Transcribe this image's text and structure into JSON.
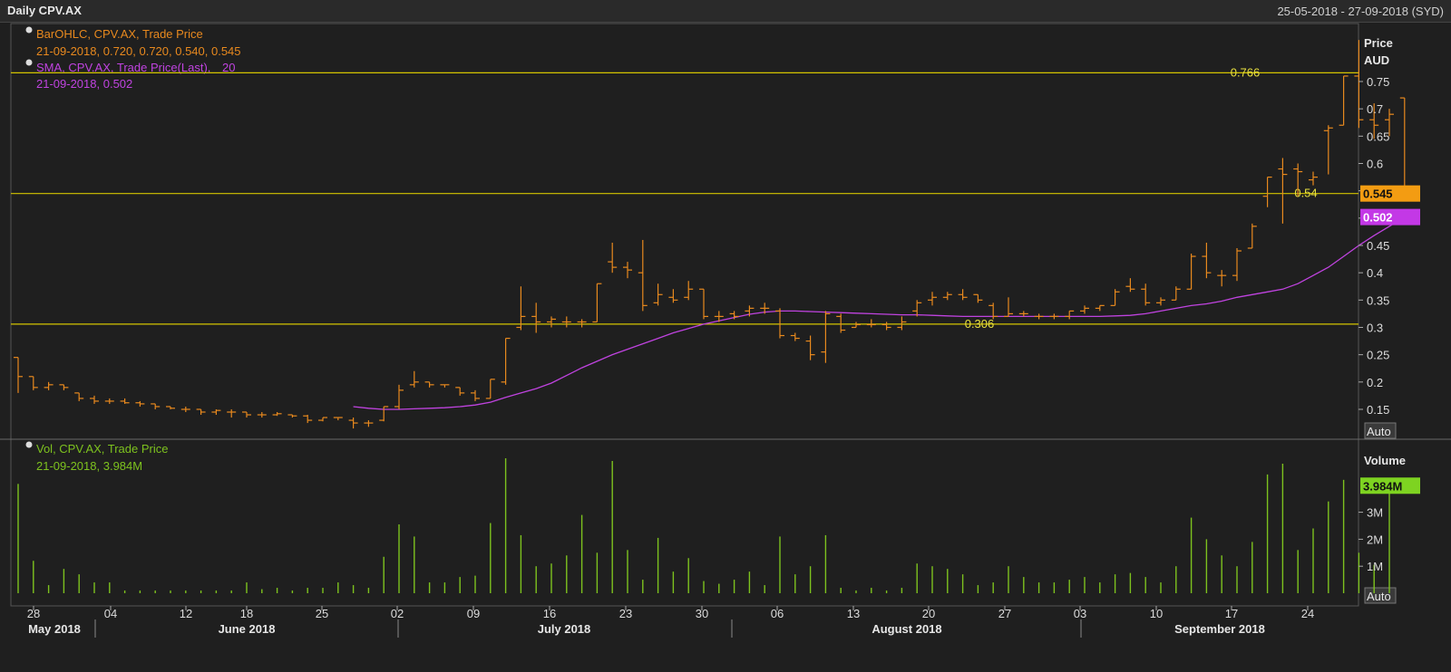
{
  "header": {
    "title": "Daily CPV.AX",
    "date_range": "25-05-2018 - 27-09-2018 (SYD)"
  },
  "legend": {
    "ohlc_label": "BarOHLC, CPV.AX, Trade Price",
    "ohlc_values": "21-09-2018, 0.720, 0.720, 0.540, 0.545",
    "sma_label": "SMA, CPV.AX, Trade Price(Last),",
    "sma_period": "20",
    "sma_values": "21-09-2018, 0.502",
    "vol_label": "Vol, CPV.AX, Trade Price",
    "vol_values": "21-09-2018, 3.984M"
  },
  "price_axis": {
    "title_line1": "Price",
    "title_line2": "AUD",
    "ticks": [
      "0.75",
      "0.7",
      "0.65",
      "0.6",
      "0.55",
      "0.5",
      "0.45",
      "0.4",
      "0.35",
      "0.3",
      "0.25",
      "0.2",
      "0.15"
    ],
    "last_price_tag": "0.545",
    "sma_tag": "0.502",
    "auto_label": "Auto"
  },
  "volume_axis": {
    "title": "Volume",
    "ticks": [
      "3M",
      "2M",
      "1M"
    ],
    "last_volume_tag": "3.984M",
    "auto_label": "Auto"
  },
  "hlines": [
    {
      "value": 0.766,
      "label": "0.766"
    },
    {
      "value": 0.545,
      "label": "0.54"
    },
    {
      "value": 0.306,
      "label": "0.306"
    }
  ],
  "time_axis": {
    "day_ticks": [
      "28",
      "04",
      "12",
      "18",
      "25",
      "02",
      "09",
      "16",
      "23",
      "30",
      "06",
      "13",
      "20",
      "27",
      "03",
      "10",
      "17",
      "24"
    ],
    "months": [
      "May 2018",
      "June 2018",
      "July 2018",
      "August 2018",
      "September 2018"
    ]
  },
  "colors": {
    "ohlc": "#e8891e",
    "sma": "#c043e0",
    "volume": "#7dc21e",
    "hline": "#d4c400",
    "last_tag": "#f39c12",
    "sma_tag": "#c338e6",
    "vol_tag": "#7ed321"
  },
  "chart_data": {
    "type": "bar",
    "title": "Daily CPV.AX",
    "ylabel": "Price AUD",
    "ylim": [
      0.115,
      0.835
    ],
    "ohlc": [
      [
        0.245,
        0.245,
        0.18,
        0.21
      ],
      [
        0.21,
        0.21,
        0.185,
        0.19
      ],
      [
        0.19,
        0.2,
        0.185,
        0.195
      ],
      [
        0.195,
        0.195,
        0.185,
        0.19
      ],
      [
        0.18,
        0.18,
        0.165,
        0.17
      ],
      [
        0.17,
        0.175,
        0.16,
        0.165
      ],
      [
        0.165,
        0.17,
        0.16,
        0.165
      ],
      [
        0.165,
        0.17,
        0.16,
        0.162
      ],
      [
        0.162,
        0.165,
        0.155,
        0.16
      ],
      [
        0.16,
        0.16,
        0.15,
        0.155
      ],
      [
        0.155,
        0.155,
        0.15,
        0.152
      ],
      [
        0.15,
        0.155,
        0.145,
        0.15
      ],
      [
        0.15,
        0.15,
        0.14,
        0.145
      ],
      [
        0.145,
        0.15,
        0.14,
        0.148
      ],
      [
        0.145,
        0.15,
        0.135,
        0.145
      ],
      [
        0.145,
        0.145,
        0.135,
        0.14
      ],
      [
        0.14,
        0.145,
        0.135,
        0.14
      ],
      [
        0.14,
        0.145,
        0.138,
        0.142
      ],
      [
        0.14,
        0.14,
        0.135,
        0.138
      ],
      [
        0.138,
        0.14,
        0.125,
        0.13
      ],
      [
        0.13,
        0.135,
        0.128,
        0.135
      ],
      [
        0.135,
        0.135,
        0.13,
        0.135
      ],
      [
        0.13,
        0.135,
        0.115,
        0.125
      ],
      [
        0.125,
        0.13,
        0.118,
        0.125
      ],
      [
        0.13,
        0.155,
        0.128,
        0.155
      ],
      [
        0.155,
        0.195,
        0.15,
        0.185
      ],
      [
        0.195,
        0.22,
        0.19,
        0.2
      ],
      [
        0.2,
        0.2,
        0.19,
        0.195
      ],
      [
        0.195,
        0.195,
        0.19,
        0.195
      ],
      [
        0.19,
        0.19,
        0.175,
        0.18
      ],
      [
        0.18,
        0.185,
        0.165,
        0.17
      ],
      [
        0.17,
        0.205,
        0.17,
        0.205
      ],
      [
        0.2,
        0.28,
        0.195,
        0.28
      ],
      [
        0.3,
        0.375,
        0.295,
        0.32
      ],
      [
        0.32,
        0.345,
        0.29,
        0.31
      ],
      [
        0.31,
        0.32,
        0.3,
        0.315
      ],
      [
        0.31,
        0.32,
        0.3,
        0.31
      ],
      [
        0.31,
        0.315,
        0.3,
        0.31
      ],
      [
        0.31,
        0.38,
        0.31,
        0.38
      ],
      [
        0.42,
        0.455,
        0.4,
        0.41
      ],
      [
        0.41,
        0.42,
        0.39,
        0.405
      ],
      [
        0.4,
        0.46,
        0.33,
        0.34
      ],
      [
        0.345,
        0.38,
        0.34,
        0.36
      ],
      [
        0.355,
        0.37,
        0.345,
        0.35
      ],
      [
        0.355,
        0.385,
        0.35,
        0.37
      ],
      [
        0.37,
        0.37,
        0.315,
        0.32
      ],
      [
        0.32,
        0.33,
        0.31,
        0.32
      ],
      [
        0.325,
        0.33,
        0.315,
        0.32
      ],
      [
        0.33,
        0.34,
        0.32,
        0.335
      ],
      [
        0.335,
        0.345,
        0.325,
        0.335
      ],
      [
        0.33,
        0.335,
        0.28,
        0.285
      ],
      [
        0.285,
        0.29,
        0.275,
        0.28
      ],
      [
        0.275,
        0.285,
        0.24,
        0.25
      ],
      [
        0.255,
        0.33,
        0.235,
        0.325
      ],
      [
        0.32,
        0.325,
        0.29,
        0.295
      ],
      [
        0.3,
        0.31,
        0.3,
        0.305
      ],
      [
        0.305,
        0.315,
        0.3,
        0.305
      ],
      [
        0.305,
        0.31,
        0.295,
        0.3
      ],
      [
        0.3,
        0.32,
        0.295,
        0.31
      ],
      [
        0.33,
        0.35,
        0.32,
        0.345
      ],
      [
        0.35,
        0.365,
        0.34,
        0.355
      ],
      [
        0.355,
        0.365,
        0.35,
        0.36
      ],
      [
        0.36,
        0.37,
        0.35,
        0.355
      ],
      [
        0.36,
        0.36,
        0.345,
        0.35
      ],
      [
        0.34,
        0.345,
        0.315,
        0.32
      ],
      [
        0.32,
        0.355,
        0.32,
        0.325
      ],
      [
        0.325,
        0.33,
        0.32,
        0.325
      ],
      [
        0.32,
        0.325,
        0.315,
        0.32
      ],
      [
        0.32,
        0.325,
        0.315,
        0.32
      ],
      [
        0.32,
        0.33,
        0.315,
        0.33
      ],
      [
        0.33,
        0.34,
        0.325,
        0.335
      ],
      [
        0.335,
        0.34,
        0.33,
        0.34
      ],
      [
        0.34,
        0.37,
        0.34,
        0.365
      ],
      [
        0.375,
        0.39,
        0.365,
        0.37
      ],
      [
        0.37,
        0.38,
        0.34,
        0.345
      ],
      [
        0.345,
        0.355,
        0.34,
        0.35
      ],
      [
        0.35,
        0.375,
        0.35,
        0.37
      ],
      [
        0.37,
        0.435,
        0.37,
        0.43
      ],
      [
        0.43,
        0.455,
        0.39,
        0.4
      ],
      [
        0.395,
        0.405,
        0.375,
        0.395
      ],
      [
        0.395,
        0.445,
        0.385,
        0.44
      ],
      [
        0.445,
        0.49,
        0.445,
        0.485
      ],
      [
        0.54,
        0.575,
        0.52,
        0.575
      ],
      [
        0.59,
        0.61,
        0.49,
        0.58
      ],
      [
        0.59,
        0.6,
        0.54,
        0.585
      ],
      [
        0.57,
        0.585,
        0.56,
        0.575
      ],
      [
        0.66,
        0.67,
        0.58,
        0.665
      ],
      [
        0.67,
        0.76,
        0.67,
        0.76
      ],
      [
        0.76,
        0.826,
        0.665,
        0.68
      ],
      [
        0.68,
        0.71,
        0.645,
        0.67
      ],
      [
        0.68,
        0.7,
        0.65,
        0.69
      ],
      [
        0.72,
        0.72,
        0.54,
        0.545
      ]
    ],
    "sma": [
      0.155,
      0.152,
      0.15,
      0.15,
      0.151,
      0.152,
      0.153,
      0.155,
      0.158,
      0.163,
      0.172,
      0.18,
      0.188,
      0.198,
      0.212,
      0.226,
      0.238,
      0.25,
      0.26,
      0.27,
      0.28,
      0.29,
      0.298,
      0.306,
      0.312,
      0.318,
      0.324,
      0.328,
      0.33,
      0.33,
      0.329,
      0.328,
      0.327,
      0.326,
      0.325,
      0.324,
      0.323,
      0.323,
      0.322,
      0.321,
      0.32,
      0.32,
      0.32,
      0.32,
      0.32,
      0.32,
      0.32,
      0.32,
      0.32,
      0.32,
      0.321,
      0.322,
      0.325,
      0.33,
      0.335,
      0.34,
      0.343,
      0.348,
      0.355,
      0.36,
      0.365,
      0.37,
      0.38,
      0.395,
      0.41,
      0.43,
      0.45,
      0.468,
      0.485,
      0.502
    ],
    "volume_millions": [
      4.05,
      1.2,
      0.3,
      0.9,
      0.7,
      0.4,
      0.4,
      0.1,
      0.1,
      0.1,
      0.1,
      0.1,
      0.1,
      0.1,
      0.1,
      0.4,
      0.15,
      0.2,
      0.1,
      0.2,
      0.2,
      0.4,
      0.3,
      0.2,
      1.35,
      2.55,
      2.1,
      0.4,
      0.4,
      0.6,
      0.65,
      2.6,
      5.0,
      2.15,
      1.0,
      1.1,
      1.4,
      2.9,
      1.5,
      4.9,
      1.6,
      0.5,
      2.05,
      0.8,
      1.3,
      0.45,
      0.35,
      0.5,
      0.8,
      0.3,
      2.1,
      0.7,
      1.0,
      2.15,
      0.2,
      0.1,
      0.2,
      0.1,
      0.2,
      1.1,
      1.0,
      0.9,
      0.7,
      0.3,
      0.4,
      1.0,
      0.6,
      0.4,
      0.4,
      0.5,
      0.6,
      0.4,
      0.7,
      0.75,
      0.6,
      0.4,
      1.0,
      2.8,
      2.0,
      1.4,
      1.0,
      1.9,
      4.4,
      4.8,
      1.6,
      2.4,
      3.4,
      4.2,
      1.5,
      1.05,
      4.0
    ],
    "volume_ylim": [
      0,
      5.2
    ]
  }
}
